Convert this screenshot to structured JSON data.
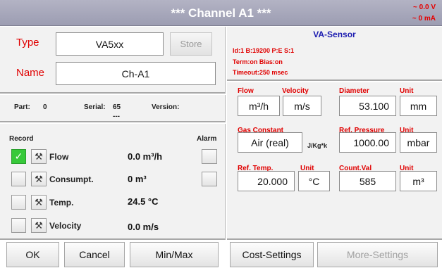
{
  "header": {
    "title": "*** Channel A1 ***",
    "status_voltage": "~ 0.0 V",
    "status_current": "~ 0 mA"
  },
  "config": {
    "type_label": "Type",
    "type_value": "VA5xx",
    "store_label": "Store",
    "name_label": "Name",
    "name_value": "Ch-A1"
  },
  "info": {
    "part_label": "Part:",
    "part_value": "0",
    "serial_label": "Serial:",
    "serial_value": "65",
    "serial_sub": "---",
    "version_label": "Version:"
  },
  "record": {
    "record_label": "Record",
    "alarm_label": "Alarm",
    "rows": [
      {
        "label": "Flow",
        "value": "0.0 m³/h",
        "checked": true
      },
      {
        "label": "Consumpt.",
        "value": "0 m³",
        "checked": false
      },
      {
        "label": "Temp.",
        "value": "24.5 °C",
        "checked": false
      },
      {
        "label": "Velocity",
        "value": "0.0 m/s",
        "checked": false
      }
    ]
  },
  "sensor": {
    "title": "VA-Sensor",
    "line1": "Id:1 B:19200 P:E S:1",
    "line2": "Term:on Bias:on",
    "line3": "Timeout:250 msec"
  },
  "params": {
    "flow_label": "Flow",
    "velocity_label": "Velocity",
    "diameter_label": "Diameter",
    "unit_label": "Unit",
    "flow_unit": "m³/h",
    "velocity_unit": "m/s",
    "diameter_value": "53.100",
    "diameter_unit": "mm",
    "gas_constant_label": "Gas Constant",
    "gas_value": "Air (real)",
    "gas_unit": "J/Kg*k",
    "ref_pressure_label": "Ref. Pressure",
    "ref_pressure_value": "1000.00",
    "ref_pressure_unit": "mbar",
    "ref_temp_label": "Ref. Temp.",
    "ref_temp_value": "20.000",
    "ref_temp_unit": "°C",
    "count_val_label": "Count.Val",
    "count_val_value": "585",
    "count_val_unit": "m³"
  },
  "buttons": {
    "ok": "OK",
    "cancel": "Cancel",
    "minmax": "Min/Max",
    "cost_settings": "Cost-Settings",
    "more_settings": "More-Settings"
  }
}
